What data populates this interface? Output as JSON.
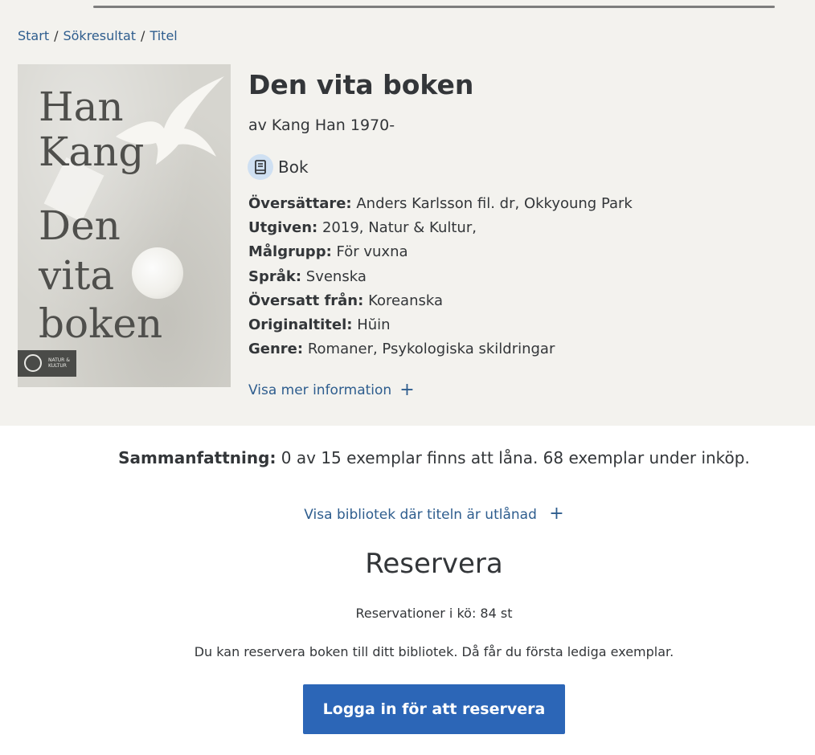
{
  "breadcrumb": {
    "start": "Start",
    "search_results": "Sökresultat",
    "current": "Titel",
    "separator": "/"
  },
  "cover": {
    "author_line1": "Han",
    "author_line2": "Kang",
    "title_line1": "Den",
    "title_line2": "vita",
    "title_line3": "boken",
    "publisher_logo_text": "NATUR & KULTUR"
  },
  "book": {
    "title": "Den vita boken",
    "author": "av Kang Han 1970-",
    "format_label": "Bok",
    "format_icon": "book-icon"
  },
  "details": [
    {
      "key": "Översättare:",
      "value": "Anders Karlsson fil. dr, Okkyoung Park"
    },
    {
      "key": "Utgiven:",
      "value": "2019, Natur & Kultur,"
    },
    {
      "key": "Målgrupp:",
      "value": "För vuxna"
    },
    {
      "key": "Språk:",
      "value": "Svenska"
    },
    {
      "key": "Översatt från:",
      "value": "Koreanska"
    },
    {
      "key": "Originaltitel:",
      "value": "Hŭin"
    },
    {
      "key": "Genre:",
      "value": "Romaner, Psykologiska skildringar"
    }
  ],
  "more_info": {
    "label": "Visa mer information",
    "icon": "+"
  },
  "summary": {
    "key": "Sammanfattning:",
    "value": "0 av 15 exemplar finns att låna. 68 exemplar under inköp."
  },
  "libraries_link": {
    "label": "Visa bibliotek där titeln är utlånad",
    "icon": "+"
  },
  "reserve": {
    "heading": "Reservera",
    "queue": "Reservationer i kö: 84 st",
    "info": "Du kan reservera boken till ditt bibliotek. Då får du första lediga exemplar.",
    "button_label": "Logga in för att reservera"
  },
  "colors": {
    "link": "#2e5d8e",
    "primary_button": "#2c66b7",
    "band": "#f3f2ee"
  }
}
